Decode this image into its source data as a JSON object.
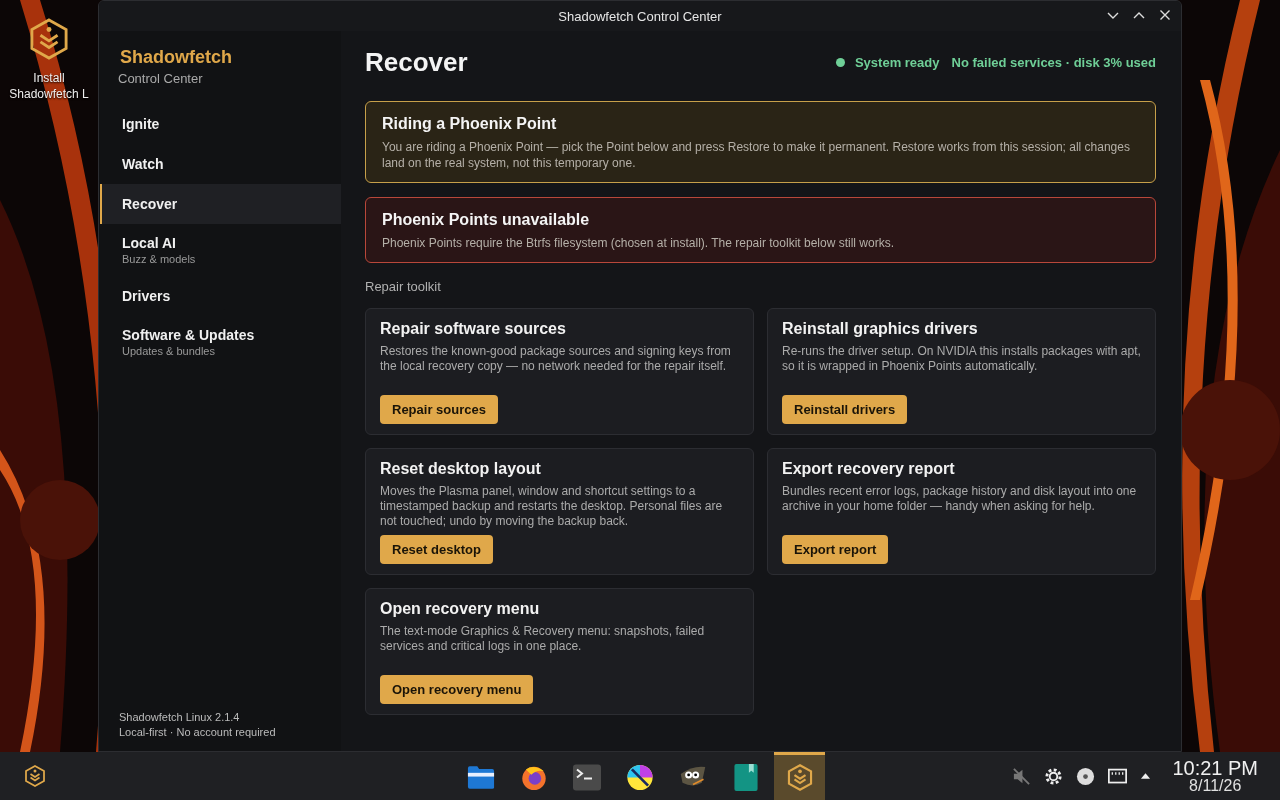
{
  "desktop": {
    "icon_label": "Install Shadowfetch L"
  },
  "window": {
    "title": "Shadowfetch Control Center"
  },
  "sidebar": {
    "brand": "Shadowfetch",
    "subtitle": "Control Center",
    "items": [
      {
        "label": "Ignite",
        "selected": false
      },
      {
        "label": "Watch",
        "selected": false
      },
      {
        "label": "Recover",
        "selected": true
      },
      {
        "label": "Local AI",
        "sublabel": "Buzz & models",
        "selected": false
      },
      {
        "label": "Drivers",
        "selected": false
      },
      {
        "label": "Software & Updates",
        "sublabel": "Updates & bundles",
        "selected": false
      }
    ],
    "footer": [
      "Shadowfetch Linux 2.1.4",
      "Local-first · No account required"
    ]
  },
  "main": {
    "title": "Recover",
    "status": "System ready",
    "status_detail": "No failed services · disk 3% used",
    "banners": [
      {
        "kind": "warning",
        "title": "Riding a Phoenix Point",
        "text": "You are riding a Phoenix Point — pick the Point below and press Restore to make it permanent. Restore works from this session; all changes land on the real system, not this temporary one."
      },
      {
        "kind": "error",
        "title": "Phoenix Points unavailable",
        "text": "Phoenix Points require the Btrfs filesystem (chosen at install). The repair toolkit below still works."
      }
    ],
    "section": "Repair toolkit",
    "tools": [
      {
        "title": "Repair software sources",
        "text": "Restores the known-good package sources and signing keys from the local recovery copy — no network needed for the repair itself.",
        "button": "Repair sources"
      },
      {
        "title": "Reinstall graphics drivers",
        "text": "Re-runs the driver setup. On NVIDIA this installs packages with apt, so it is wrapped in Phoenix Points automatically.",
        "button": "Reinstall drivers"
      },
      {
        "title": "Reset desktop layout",
        "text": "Moves the Plasma panel, window and shortcut settings to a timestamped backup and restarts the desktop. Personal files are not touched; undo by moving the backup back.",
        "button": "Reset desktop"
      },
      {
        "title": "Export recovery report",
        "text": "Bundles recent error logs, package history and disk layout into one archive in your home folder — handy when asking for help.",
        "button": "Export report"
      },
      {
        "title": "Open recovery menu",
        "text": "The text-mode Graphics & Recovery menu: snapshots, failed services and critical logs in one place.",
        "button": "Open recovery menu"
      }
    ]
  },
  "taskbar": {
    "apps": [
      {
        "kind": "files",
        "selected": false
      },
      {
        "kind": "browser",
        "selected": false
      },
      {
        "kind": "terminal",
        "selected": false
      },
      {
        "kind": "paint",
        "selected": false
      },
      {
        "kind": "gimp",
        "selected": false
      },
      {
        "kind": "notes",
        "selected": false
      },
      {
        "kind": "shadowfetch",
        "selected": true
      }
    ],
    "time": "10:21 PM",
    "date": "8/11/26"
  }
}
